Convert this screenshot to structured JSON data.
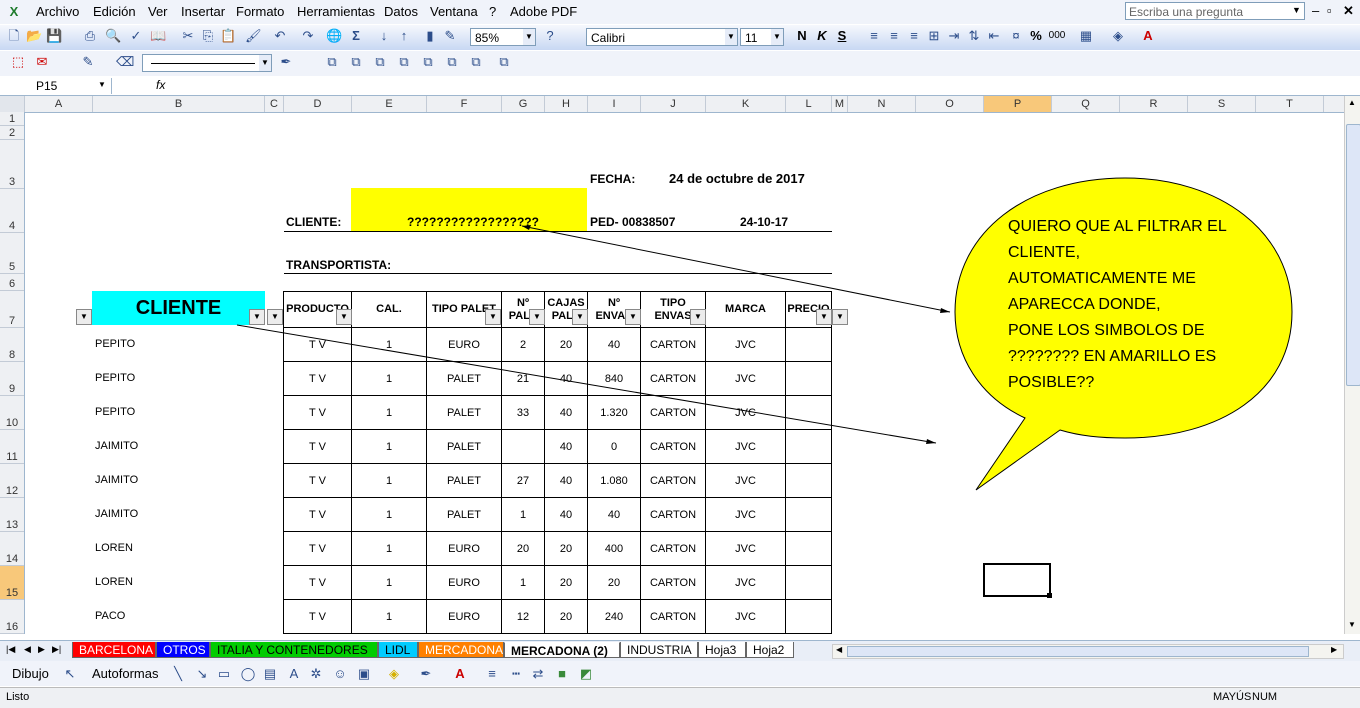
{
  "menu": [
    "Archivo",
    "Edición",
    "Ver",
    "Insertar",
    "Formato",
    "Herramientas",
    "Datos",
    "Ventana",
    "?",
    "Adobe PDF"
  ],
  "ask_placeholder": "Escriba una pregunta",
  "toolbar": {
    "zoom": "85%",
    "font": "Calibri",
    "font_size": "11",
    "percent": "%",
    "thousands": "000"
  },
  "formula_bar": {
    "name_box": "P15",
    "fx": "fx"
  },
  "columns": [
    "A",
    "B",
    "C",
    "D",
    "E",
    "F",
    "G",
    "H",
    "I",
    "J",
    "K",
    "L",
    "M",
    "N",
    "O",
    "P",
    "Q",
    "R",
    "S",
    "T"
  ],
  "rows": [
    "1",
    "2",
    "3",
    "4",
    "5",
    "6",
    "7",
    "8",
    "9",
    "10",
    "11",
    "12",
    "13",
    "14",
    "15",
    "16"
  ],
  "header_info": {
    "fecha_label": "FECHA:",
    "fecha_value": "24 de octubre de 2017",
    "cliente_label": "CLIENTE:",
    "cliente_value": "??????????????????",
    "pedido": "PED- 00838507",
    "pedido_date": "24-10-17",
    "transportista_label": "TRANSPORTISTA:"
  },
  "table": {
    "cliente_header": "CLIENTE",
    "headers": [
      "PRODUCTO",
      "CAL.",
      "TIPO PALET",
      "Nº\nPALE",
      "CAJAS\nPALE",
      "Nº\nENVAS",
      "TIPO\nENVAS",
      "MARCA",
      "PRECIO"
    ],
    "rows": [
      [
        "PEPITO",
        "T V",
        "1",
        "EURO",
        "2",
        "20",
        "40",
        "CARTON",
        "JVC",
        ""
      ],
      [
        "PEPITO",
        "T V",
        "1",
        "PALET",
        "21",
        "40",
        "840",
        "CARTON",
        "JVC",
        ""
      ],
      [
        "PEPITO",
        "T V",
        "1",
        "PALET",
        "33",
        "40",
        "1.320",
        "CARTON",
        "JVC",
        ""
      ],
      [
        "JAIMITO",
        "T V",
        "1",
        "PALET",
        "",
        "40",
        "0",
        "CARTON",
        "JVC",
        ""
      ],
      [
        "JAIMITO",
        "T V",
        "1",
        "PALET",
        "27",
        "40",
        "1.080",
        "CARTON",
        "JVC",
        ""
      ],
      [
        "JAIMITO",
        "T V",
        "1",
        "PALET",
        "1",
        "40",
        "40",
        "CARTON",
        "JVC",
        ""
      ],
      [
        "LOREN",
        "T V",
        "1",
        "EURO",
        "20",
        "20",
        "400",
        "CARTON",
        "JVC",
        ""
      ],
      [
        "LOREN",
        "T V",
        "1",
        "EURO",
        "1",
        "20",
        "20",
        "CARTON",
        "JVC",
        ""
      ],
      [
        "PACO",
        "T V",
        "1",
        "EURO",
        "12",
        "20",
        "240",
        "CARTON",
        "JVC",
        ""
      ]
    ]
  },
  "callout_text": "QUIERO QUE AL FILTRAR EL CLIENTE, AUTOMATICAMENTE ME APARECCA DONDE, PONE LOS SIMBOLOS DE ???????? EN AMARILLO ES POSIBLE??",
  "callout_lines": [
    "QUIERO QUE AL FILTRAR EL",
    "CLIENTE,",
    "AUTOMATICAMENTE ME",
    "APARECCA DONDE,",
    "PONE LOS SIMBOLOS DE",
    "???????? EN AMARILLO ES",
    "POSIBLE??"
  ],
  "sheet_tabs": [
    {
      "label": "BARCELONA",
      "color": "#ff0000"
    },
    {
      "label": "OTROS",
      "color": "#0000ff"
    },
    {
      "label": "ITALIA Y CONTENEDORES",
      "color": "#00cc00"
    },
    {
      "label": "LIDL",
      "color": "#00ccff"
    },
    {
      "label": "MERCADONA",
      "color": "#ff8000"
    },
    {
      "label": "MERCADONA (2)",
      "color": "#ffffff"
    },
    {
      "label": "INDUSTRIA",
      "color": "#ffffff"
    },
    {
      "label": "Hoja3",
      "color": "#ffffff"
    },
    {
      "label": "Hoja2",
      "color": "#ffffff"
    }
  ],
  "drawing_toolbar": {
    "draw": "Dibujo",
    "autoshapes": "Autoformas"
  },
  "status": {
    "ready": "Listo",
    "caps": "MAYÚS",
    "num": "NUM"
  }
}
